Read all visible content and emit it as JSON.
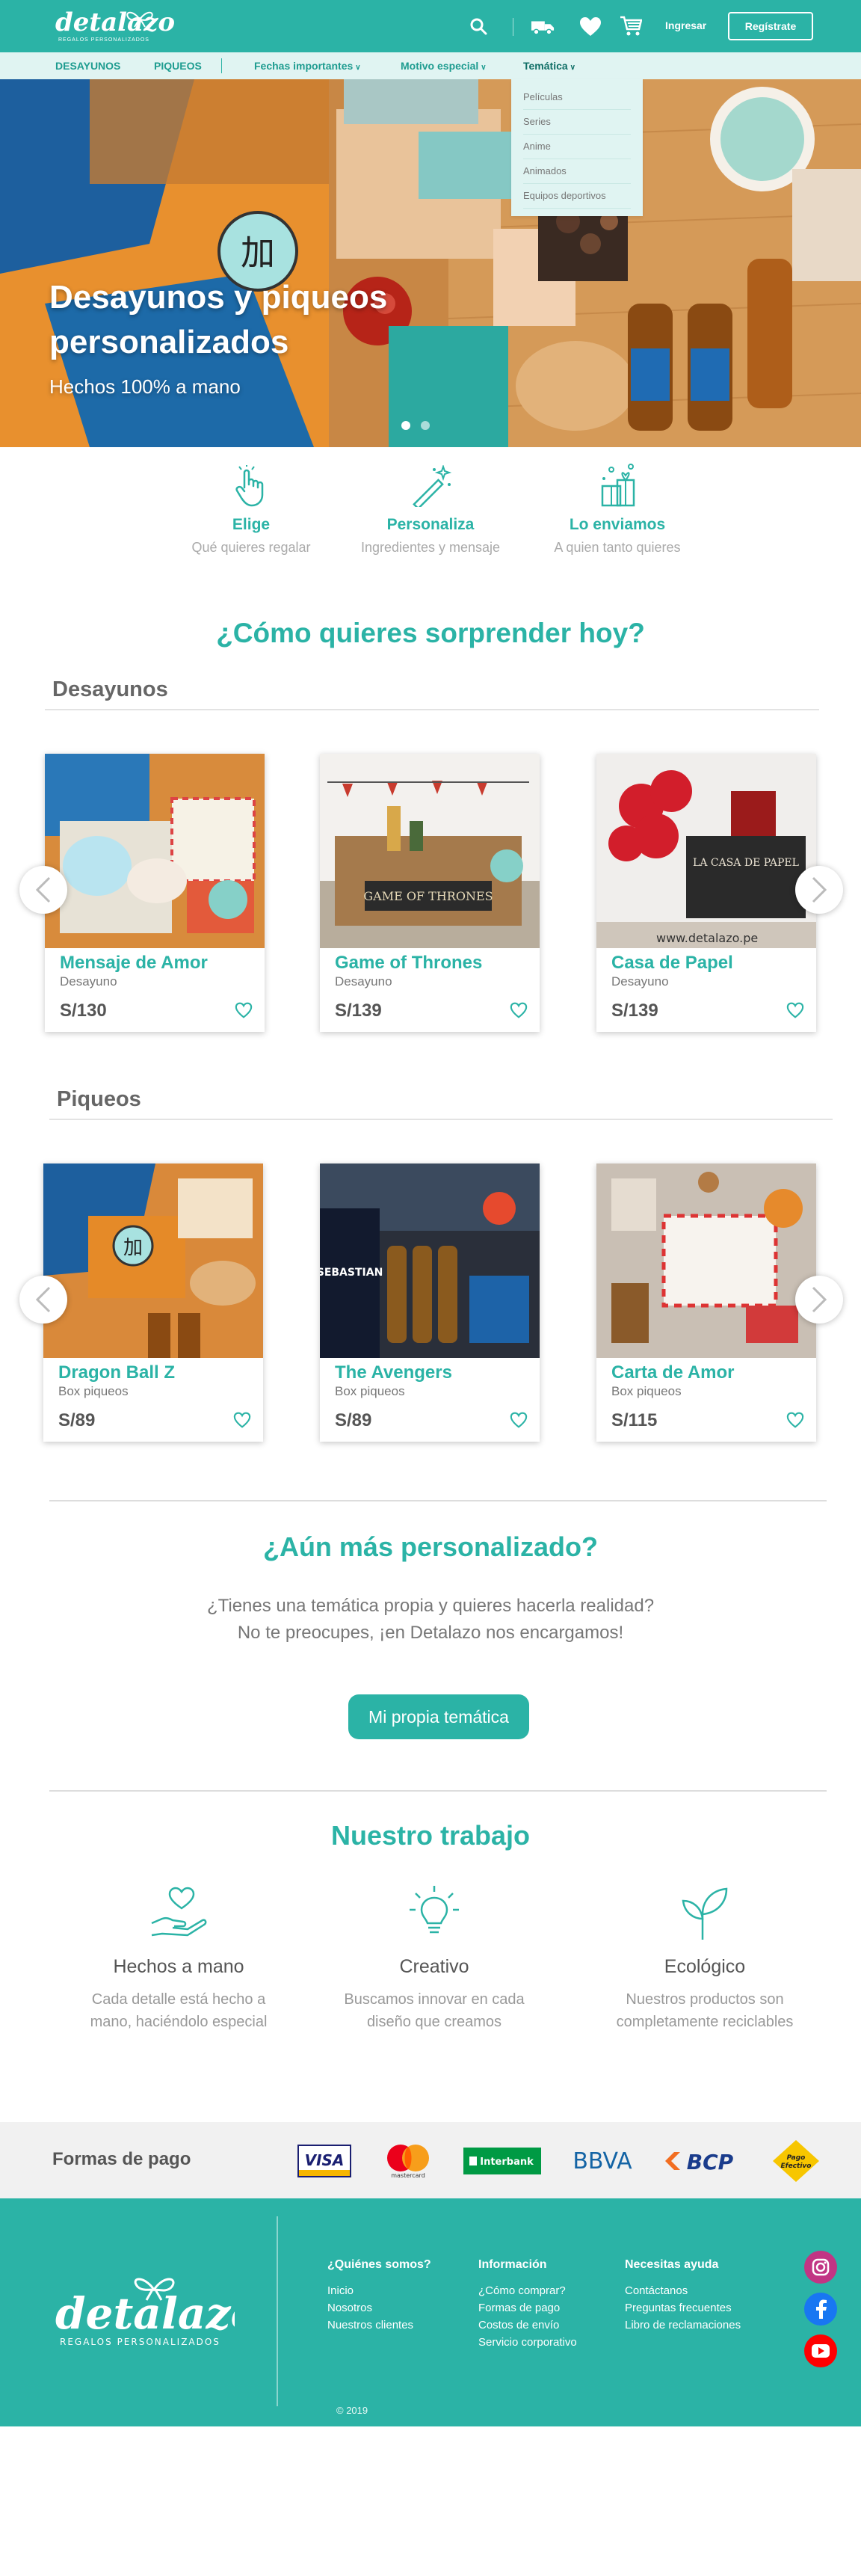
{
  "header": {
    "logo_text": "detalazo",
    "logo_sub": "REGALOS PERSONALIZADOS",
    "login_label": "Ingresar",
    "register_label": "Regístrate"
  },
  "nav": {
    "items": [
      {
        "label": "DESAYUNOS"
      },
      {
        "label": "PIQUEOS"
      },
      {
        "label": "Fechas importantes"
      },
      {
        "label": "Motivo especial"
      },
      {
        "label": "Temática"
      }
    ],
    "dropdown": [
      "Películas",
      "Series",
      "Anime",
      "Animados",
      "Equipos deportivos"
    ]
  },
  "hero": {
    "title": "Desayunos y piqueos personalizados",
    "subtitle": "Hechos 100% a mano"
  },
  "steps": [
    {
      "title": "Elige",
      "desc": "Qué quieres regalar"
    },
    {
      "title": "Personaliza",
      "desc": "Ingredientes y mensaje"
    },
    {
      "title": "Lo enviamos",
      "desc": "A quien tanto quieres"
    }
  ],
  "main_title": "¿Cómo quieres sorprender hoy?",
  "sections": [
    {
      "title": "Desayunos",
      "products": [
        {
          "name": "Mensaje de Amor",
          "category": "Desayuno",
          "price": "S/130"
        },
        {
          "name": "Game of Thrones",
          "category": "Desayuno",
          "price": "S/139"
        },
        {
          "name": "Casa de Papel",
          "category": "Desayuno",
          "price": "S/139"
        }
      ]
    },
    {
      "title": "Piqueos",
      "products": [
        {
          "name": "Dragon Ball Z",
          "category": "Box piqueos",
          "price": "S/89"
        },
        {
          "name": "The Avengers",
          "category": "Box piqueos",
          "price": "S/89"
        },
        {
          "name": "Carta de Amor",
          "category": "Box piqueos",
          "price": "S/115"
        }
      ]
    }
  ],
  "custom": {
    "title": "¿Aún más personalizado?",
    "line1": "¿Tienes una temática propia y quieres hacerla realidad?",
    "line2": "No te preocupes, ¡en Detalazo nos encargamos!",
    "cta": "Mi propia temática"
  },
  "work": {
    "title": "Nuestro trabajo",
    "features": [
      {
        "title": "Hechos a mano",
        "desc1": "Cada detalle está hecho a",
        "desc2": "mano, haciéndolo especial"
      },
      {
        "title": "Creativo",
        "desc1": "Buscamos innovar en cada",
        "desc2": "diseño que creamos"
      },
      {
        "title": "Ecológico",
        "desc1": "Nuestros productos son",
        "desc2": "completamente reciclables"
      }
    ]
  },
  "payments": {
    "label": "Formas de pago",
    "methods": [
      "VISA",
      "mastercard",
      "Interbank",
      "BBVA",
      "BCP",
      "Pago Efectivo"
    ]
  },
  "footer": {
    "columns": [
      {
        "heading": "¿Quiénes somos?",
        "links": [
          "Inicio",
          "Nosotros",
          "Nuestros clientes"
        ]
      },
      {
        "heading": "Información",
        "links": [
          "¿Cómo comprar?",
          "Formas de pago",
          "Costos de envío",
          "Servicio corporativo"
        ]
      },
      {
        "heading": "Necesitas ayuda",
        "links": [
          "Contáctanos",
          "Preguntas frecuentes",
          "Libro de reclamaciones"
        ]
      }
    ],
    "copyright": "© 2019"
  },
  "colors": {
    "brand": "#2bb3a6",
    "nav_bg": "#e0f4f2",
    "footer_bg": "#2bb3a6"
  }
}
